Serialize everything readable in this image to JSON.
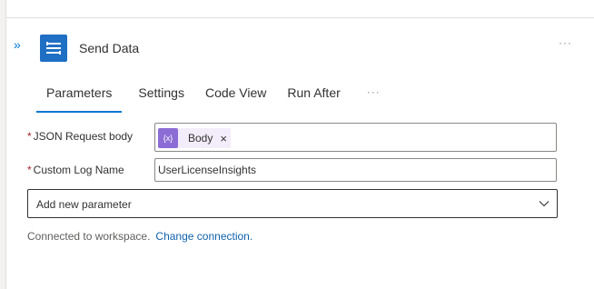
{
  "action": {
    "title": "Send Data",
    "icon": "data-transfer-icon",
    "accent": "#1f6fc4",
    "more_label": "···",
    "expand_label": "»"
  },
  "tabs": [
    {
      "label": "Parameters",
      "active": true
    },
    {
      "label": "Settings",
      "active": false
    },
    {
      "label": "Code View",
      "active": false
    },
    {
      "label": "Run After",
      "active": false
    }
  ],
  "tabs_more_label": "···",
  "fields": {
    "json_body": {
      "required_mark": "*",
      "label": "JSON Request body",
      "token": {
        "icon_text": "{x}",
        "label": "Body",
        "remove": "×",
        "color": "#8c6cd5"
      }
    },
    "custom_log_name": {
      "required_mark": "*",
      "label": "Custom Log Name",
      "value": "UserLicenseInsights"
    }
  },
  "add_parameter": {
    "placeholder": "Add new parameter"
  },
  "connection": {
    "status_text": "Connected to workspace.",
    "change_link": "Change connection."
  }
}
